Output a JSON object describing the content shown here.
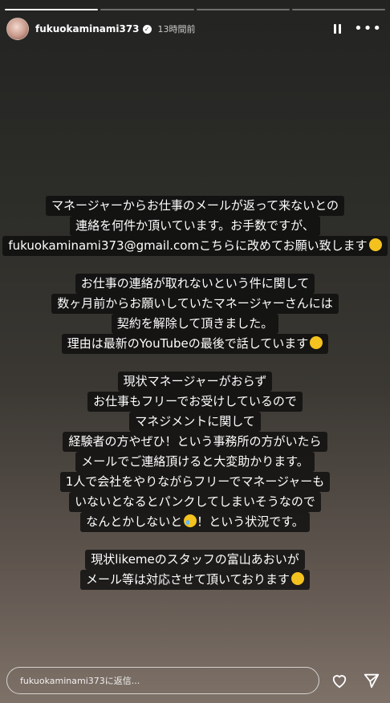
{
  "progress": {
    "segments": 4,
    "completed": 1
  },
  "header": {
    "username": "fukuokaminami373",
    "time": "13時間前",
    "more_label": "•••"
  },
  "story": {
    "p1": [
      "マネージャーからお仕事のメールが返って来ないとの",
      "連絡を何件か頂いています。お手数ですが、",
      "fukuokaminami373@gmail.comこちらに改めてお願い致します"
    ],
    "p2": [
      "お仕事の連絡が取れないという件に関して",
      "数ヶ月前からお願いしていたマネージャーさんには",
      "契約を解除して頂きました。",
      "理由は最新のYouTubeの最後で話しています"
    ],
    "p3": [
      "現状マネージャーがおらず",
      "お仕事もフリーでお受けしているので",
      "マネジメントに関して",
      "経験者の方やぜひ！という事務所の方がいたら",
      "メールでご連絡頂けると大変助かります。",
      "1人で会社をやりながらフリーでマネージャーも",
      "いないとなるとパンクしてしまいそうなので",
      "なんとかしないと",
      "！という状況です。"
    ],
    "p4": [
      "現状likemeのスタッフの富山あおいが",
      "メール等は対応させて頂いております"
    ]
  },
  "footer": {
    "reply_placeholder": "fukuokaminami373に返信..."
  },
  "icons": {
    "verified": "verified-badge-icon",
    "pause": "pause-icon",
    "more": "more-icon",
    "heart": "heart-icon",
    "send": "send-icon",
    "emoji_bow": "bowing-emoji-icon",
    "emoji_cry": "crying-emoji-icon"
  }
}
